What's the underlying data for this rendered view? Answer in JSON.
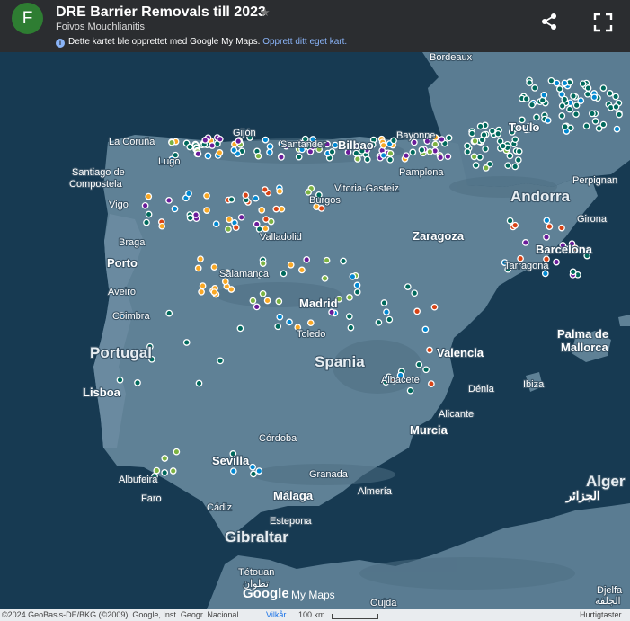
{
  "header": {
    "avatar_letter": "F",
    "title": "DRE Barrier Removals till 2023",
    "author": "Foivos Mouchlianitis",
    "info_text": "Dette kartet ble opprettet med Google My Maps.",
    "create_link": "Opprett ditt eget kart."
  },
  "icons": [
    "info-icon",
    "star-icon",
    "share-icon",
    "fullscreen-icon"
  ],
  "colors": {
    "header_bg": "#2b2d30",
    "sea": "#173a52",
    "land": "#5f8196",
    "marker_teal": "#00695c",
    "marker_purple": "#6a1b9a",
    "marker_yellow": "#f9a825",
    "marker_green": "#7cb342",
    "marker_blue": "#0288d1",
    "marker_red": "#d84315"
  },
  "map_labels": {
    "countries": [
      "Portugal",
      "Spania",
      "Andorra",
      "Gibraltar"
    ],
    "cities": [
      "Bordeaux",
      "Toulo",
      "Gijón",
      "Santander",
      "Bilbao",
      "Bayonne",
      "La Coruña",
      "Lugo",
      "Santiago de",
      "Compostela",
      "Vitoria-Gasteiz",
      "Pamplona",
      "Burgos",
      "Vigo",
      "Braga",
      "Valladolid",
      "Zaragoza",
      "Perpignan",
      "Girona",
      "Barcelona",
      "Tarragona",
      "Porto",
      "Salamanca",
      "Aveiro",
      "Coimbra",
      "Madrid",
      "Toledo",
      "Palma de",
      "Mallorca",
      "Valencia",
      "Lisboa",
      "Dénia",
      "Ibiza",
      "Albacete",
      "Alicante",
      "Murcia",
      "Córdoba",
      "Sevilla",
      "Granada",
      "Almería",
      "Albufeira",
      "Faro",
      "Málaga",
      "Cádiz",
      "Estepona",
      "Alger",
      "الجزائر",
      "Tétouan",
      "تطوان",
      "Oujda",
      "Djelfa",
      "الجلفة"
    ]
  },
  "footer": {
    "attribution": "©2024 GeoBasis-DE/BKG (©2009), Google, Inst. Geogr. Nacional",
    "terms": "Vilkår",
    "scale": "100 km",
    "shortcuts": "Hurtigtaster"
  },
  "branding": {
    "google": "Google",
    "mymaps": "My Maps"
  }
}
